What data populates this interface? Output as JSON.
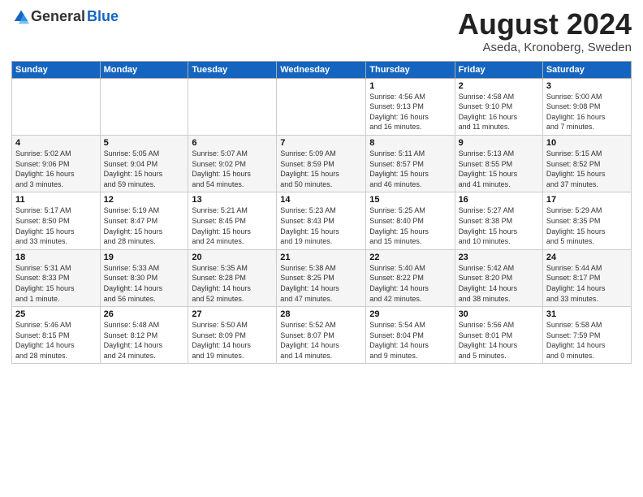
{
  "header": {
    "logo_general": "General",
    "logo_blue": "Blue",
    "title": "August 2024",
    "subtitle": "Aseda, Kronoberg, Sweden"
  },
  "weekdays": [
    "Sunday",
    "Monday",
    "Tuesday",
    "Wednesday",
    "Thursday",
    "Friday",
    "Saturday"
  ],
  "weeks": [
    [
      {
        "day": "",
        "info": ""
      },
      {
        "day": "",
        "info": ""
      },
      {
        "day": "",
        "info": ""
      },
      {
        "day": "",
        "info": ""
      },
      {
        "day": "1",
        "info": "Sunrise: 4:56 AM\nSunset: 9:13 PM\nDaylight: 16 hours\nand 16 minutes."
      },
      {
        "day": "2",
        "info": "Sunrise: 4:58 AM\nSunset: 9:10 PM\nDaylight: 16 hours\nand 11 minutes."
      },
      {
        "day": "3",
        "info": "Sunrise: 5:00 AM\nSunset: 9:08 PM\nDaylight: 16 hours\nand 7 minutes."
      }
    ],
    [
      {
        "day": "4",
        "info": "Sunrise: 5:02 AM\nSunset: 9:06 PM\nDaylight: 16 hours\nand 3 minutes."
      },
      {
        "day": "5",
        "info": "Sunrise: 5:05 AM\nSunset: 9:04 PM\nDaylight: 15 hours\nand 59 minutes."
      },
      {
        "day": "6",
        "info": "Sunrise: 5:07 AM\nSunset: 9:02 PM\nDaylight: 15 hours\nand 54 minutes."
      },
      {
        "day": "7",
        "info": "Sunrise: 5:09 AM\nSunset: 8:59 PM\nDaylight: 15 hours\nand 50 minutes."
      },
      {
        "day": "8",
        "info": "Sunrise: 5:11 AM\nSunset: 8:57 PM\nDaylight: 15 hours\nand 46 minutes."
      },
      {
        "day": "9",
        "info": "Sunrise: 5:13 AM\nSunset: 8:55 PM\nDaylight: 15 hours\nand 41 minutes."
      },
      {
        "day": "10",
        "info": "Sunrise: 5:15 AM\nSunset: 8:52 PM\nDaylight: 15 hours\nand 37 minutes."
      }
    ],
    [
      {
        "day": "11",
        "info": "Sunrise: 5:17 AM\nSunset: 8:50 PM\nDaylight: 15 hours\nand 33 minutes."
      },
      {
        "day": "12",
        "info": "Sunrise: 5:19 AM\nSunset: 8:47 PM\nDaylight: 15 hours\nand 28 minutes."
      },
      {
        "day": "13",
        "info": "Sunrise: 5:21 AM\nSunset: 8:45 PM\nDaylight: 15 hours\nand 24 minutes."
      },
      {
        "day": "14",
        "info": "Sunrise: 5:23 AM\nSunset: 8:43 PM\nDaylight: 15 hours\nand 19 minutes."
      },
      {
        "day": "15",
        "info": "Sunrise: 5:25 AM\nSunset: 8:40 PM\nDaylight: 15 hours\nand 15 minutes."
      },
      {
        "day": "16",
        "info": "Sunrise: 5:27 AM\nSunset: 8:38 PM\nDaylight: 15 hours\nand 10 minutes."
      },
      {
        "day": "17",
        "info": "Sunrise: 5:29 AM\nSunset: 8:35 PM\nDaylight: 15 hours\nand 5 minutes."
      }
    ],
    [
      {
        "day": "18",
        "info": "Sunrise: 5:31 AM\nSunset: 8:33 PM\nDaylight: 15 hours\nand 1 minute."
      },
      {
        "day": "19",
        "info": "Sunrise: 5:33 AM\nSunset: 8:30 PM\nDaylight: 14 hours\nand 56 minutes."
      },
      {
        "day": "20",
        "info": "Sunrise: 5:35 AM\nSunset: 8:28 PM\nDaylight: 14 hours\nand 52 minutes."
      },
      {
        "day": "21",
        "info": "Sunrise: 5:38 AM\nSunset: 8:25 PM\nDaylight: 14 hours\nand 47 minutes."
      },
      {
        "day": "22",
        "info": "Sunrise: 5:40 AM\nSunset: 8:22 PM\nDaylight: 14 hours\nand 42 minutes."
      },
      {
        "day": "23",
        "info": "Sunrise: 5:42 AM\nSunset: 8:20 PM\nDaylight: 14 hours\nand 38 minutes."
      },
      {
        "day": "24",
        "info": "Sunrise: 5:44 AM\nSunset: 8:17 PM\nDaylight: 14 hours\nand 33 minutes."
      }
    ],
    [
      {
        "day": "25",
        "info": "Sunrise: 5:46 AM\nSunset: 8:15 PM\nDaylight: 14 hours\nand 28 minutes."
      },
      {
        "day": "26",
        "info": "Sunrise: 5:48 AM\nSunset: 8:12 PM\nDaylight: 14 hours\nand 24 minutes."
      },
      {
        "day": "27",
        "info": "Sunrise: 5:50 AM\nSunset: 8:09 PM\nDaylight: 14 hours\nand 19 minutes."
      },
      {
        "day": "28",
        "info": "Sunrise: 5:52 AM\nSunset: 8:07 PM\nDaylight: 14 hours\nand 14 minutes."
      },
      {
        "day": "29",
        "info": "Sunrise: 5:54 AM\nSunset: 8:04 PM\nDaylight: 14 hours\nand 9 minutes."
      },
      {
        "day": "30",
        "info": "Sunrise: 5:56 AM\nSunset: 8:01 PM\nDaylight: 14 hours\nand 5 minutes."
      },
      {
        "day": "31",
        "info": "Sunrise: 5:58 AM\nSunset: 7:59 PM\nDaylight: 14 hours\nand 0 minutes."
      }
    ]
  ]
}
